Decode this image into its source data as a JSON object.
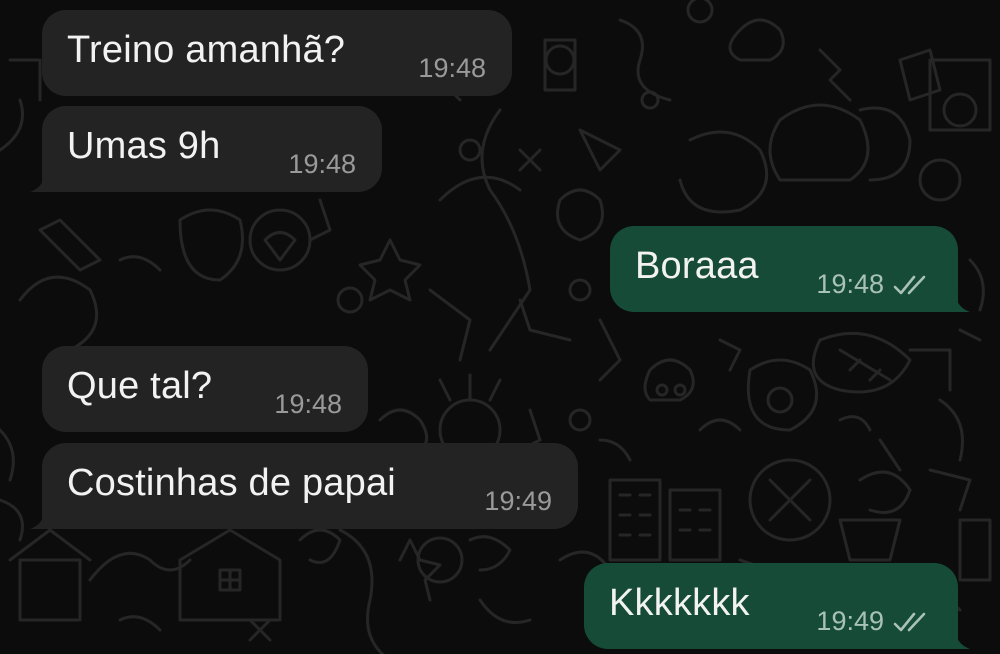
{
  "colors": {
    "background": "#0c0c0c",
    "incoming_bubble": "#232323",
    "outgoing_bubble": "#154b37",
    "text": "#f2f2f2",
    "timestamp": "#9a9a9a",
    "read_ticks": "#a9c2b6"
  },
  "messages": [
    {
      "direction": "incoming",
      "text": "Treino amanhã?",
      "time": "19:48"
    },
    {
      "direction": "incoming",
      "text": "Umas 9h",
      "time": "19:48"
    },
    {
      "direction": "outgoing",
      "text": "Boraaa",
      "time": "19:48",
      "status_icon": "double-check-icon"
    },
    {
      "direction": "incoming",
      "text": "Que tal?",
      "time": "19:48"
    },
    {
      "direction": "incoming",
      "text": "Costinhas de papai",
      "time": "19:49"
    },
    {
      "direction": "outgoing",
      "text": "Kkkkkkk",
      "time": "19:49",
      "status_icon": "double-check-icon"
    }
  ]
}
